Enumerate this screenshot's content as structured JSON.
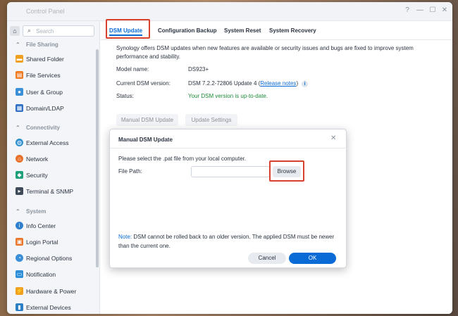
{
  "window": {
    "title": "Control Panel",
    "controls": [
      "?",
      "—",
      "☐",
      "✕"
    ]
  },
  "sidebar": {
    "search_placeholder": "Search",
    "sections": [
      {
        "title": "File Sharing",
        "items": [
          "Shared Folder",
          "File Services",
          "User & Group",
          "Domain/LDAP"
        ]
      },
      {
        "title": "Connectivity",
        "items": [
          "External Access",
          "Network",
          "Security",
          "Terminal & SNMP"
        ]
      },
      {
        "title": "System",
        "items": [
          "Info Center",
          "Login Portal",
          "Regional Options",
          "Notification",
          "Hardware & Power",
          "External Devices"
        ]
      }
    ]
  },
  "tabs": [
    "DSM Update",
    "Configuration Backup",
    "System Reset",
    "System Recovery"
  ],
  "active_tab": "DSM Update",
  "main": {
    "description": "Synology offers DSM updates when new features are available or security issues and bugs are fixed to improve system performance and stability.",
    "model_label": "Model name:",
    "model_value": "DS923+",
    "version_label": "Current DSM version:",
    "version_value": "DSM 7.2.2-72806 Update 4 (",
    "release_notes": "Release notes",
    "version_close": ")",
    "status_label": "Status:",
    "status_value": "Your DSM version is up-to-date.",
    "manual_update_btn": "Manual DSM Update",
    "update_settings_btn": "Update Settings"
  },
  "modal": {
    "title": "Manual DSM Update",
    "close": "✕",
    "instruction": "Please select the .pat file from your local computer.",
    "file_path_label": "File Path:",
    "file_path_value": "",
    "browse_btn": "Browse",
    "note_label": "Note:",
    "note_text": " DSM cannot be rolled back to an older version. The applied DSM must be newer than the current one.",
    "cancel_btn": "Cancel",
    "ok_btn": "OK"
  },
  "colors": {
    "accent": "#0a6bd6",
    "highlight": "#d9412f",
    "ok": "#1f8a3b"
  }
}
